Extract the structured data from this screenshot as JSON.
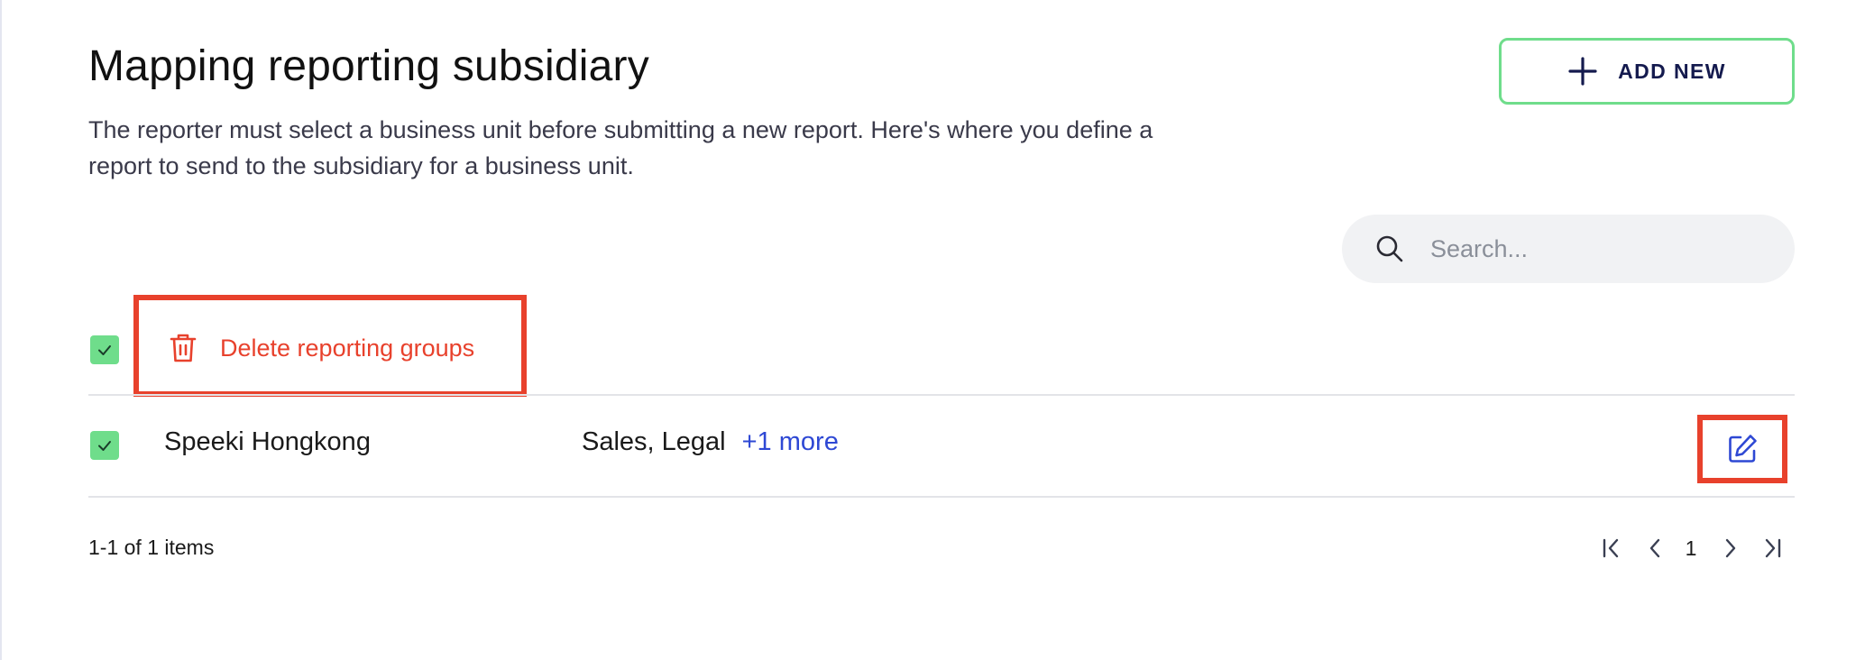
{
  "page": {
    "title": "Mapping reporting subsidiary",
    "description": "The reporter must select a business unit before submitting a new report. Here's where you define a report to send to the subsidiary for a business unit."
  },
  "actions": {
    "add_new_label": "ADD NEW",
    "add_icon": "plus-icon"
  },
  "search": {
    "placeholder": "Search...",
    "value": "",
    "icon": "search-icon"
  },
  "bulk_actions": {
    "select_all_checked": true,
    "delete_label": "Delete reporting groups",
    "delete_icon": "trash-icon"
  },
  "table": {
    "rows": [
      {
        "checked": true,
        "name": "Speeki Hongkong",
        "business_units": "Sales, Legal",
        "more_label": "+1 more",
        "edit_icon": "edit-icon"
      }
    ]
  },
  "pagination": {
    "summary": "1-1 of 1 items",
    "current_page": "1",
    "icons": [
      "first-page-icon",
      "previous-page-icon",
      "next-page-icon",
      "last-page-icon"
    ]
  },
  "colors": {
    "accent_green": "#6fdd8b",
    "danger_red": "#e8412c",
    "link_blue": "#2e48d4",
    "navy": "#141a4e"
  }
}
